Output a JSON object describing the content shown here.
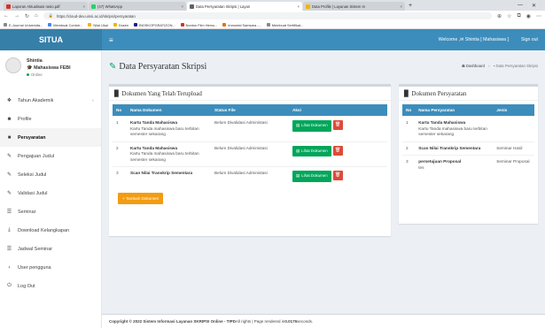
{
  "browser": {
    "tabs": [
      {
        "label": "Laporan Aktualisasi rasio.pdf",
        "color": "#d93025",
        "active": false
      },
      {
        "label": "(47) WhatsApp",
        "color": "#25d366",
        "active": false
      },
      {
        "label": "Data Persyaratan Skripsi | Layan",
        "color": "#5f6368",
        "active": true
      },
      {
        "label": "Data Profile | Layanan Sistem In",
        "color": "#f4b400",
        "active": false
      }
    ],
    "new_tab": "+",
    "url": "https://cloud-dev.uinsi.ac.id/skripsi/persyaratan",
    "bookmarks": [
      "E-Journal Universita...",
      "Membuat Contoh...",
      "Nilai Ukai",
      "Dosen",
      "BIOSKOPGRATIZON...",
      "Nonton Film Hemu...",
      "Immortal Samsara -...",
      "Membuat Sertifikat..."
    ]
  },
  "app": {
    "brand": "SITUA",
    "welcome": "Welcome ,✉ Shintia [ Mahasiswa ]",
    "signout": "Sign out"
  },
  "user": {
    "name": "Shintia",
    "role": "Mahasiswa FEBI",
    "status": "Online"
  },
  "sidebar": {
    "items": [
      {
        "label": "Tahun Akademik",
        "icon": "❖"
      },
      {
        "label": "Profile",
        "icon": "☻"
      },
      {
        "label": "Persyaratan",
        "icon": "■"
      },
      {
        "label": "Pengajuan Judul",
        "icon": "✎"
      },
      {
        "label": "Seleksi Judul",
        "icon": "✎"
      },
      {
        "label": "Validasi Judul",
        "icon": "✎"
      },
      {
        "label": "Seminar",
        "icon": "☰"
      },
      {
        "label": "Download Kelangkapan",
        "icon": "⤓"
      },
      {
        "label": "Jadwal Seminar",
        "icon": "☰"
      },
      {
        "label": "User pengguna",
        "icon": "‹"
      },
      {
        "label": "Log Out",
        "icon": "⏻"
      }
    ]
  },
  "page": {
    "title": "Data Persyaratan Skripsi",
    "breadcrumb_home": "Dashboard",
    "breadcrumb_current": "Data Persyaratan Skripsi"
  },
  "uploaded": {
    "title": "Dokumen Yang Telah Terupload",
    "headers": [
      "No",
      "Nama Dokumen",
      "Status File",
      "Aksi"
    ],
    "rows": [
      {
        "no": "1",
        "name": "Kartu Tanda Mahasiswa",
        "desc": "Kartu Tanda mahasiswa baru terbitan semester sekarang",
        "status": "Belum Divalidasi Administasi"
      },
      {
        "no": "2",
        "name": "Kartu Tanda Mahasiswa",
        "desc": "Kartu Tanda mahasiswa baru terbitan semester sekarang",
        "status": "Belum Divalidasi Administasi"
      },
      {
        "no": "3",
        "name": "Scan Nilai Transkrip Sementara",
        "desc": "",
        "status": "Belum Divalidasi Administasi"
      }
    ],
    "view_label": "Lihat Dokumen",
    "add_label": "+ Tambah Dokumen"
  },
  "requirements": {
    "title": "Dokumen Persyaratan",
    "headers": [
      "No",
      "Nama Persyaratan",
      "Jenis"
    ],
    "rows": [
      {
        "no": "1",
        "name": "Kartu Tanda Mahasiswa",
        "desc": "Kartu Tanda mahasiswa baru terbitan semester sekarang",
        "jenis": ""
      },
      {
        "no": "2",
        "name": "Scan Nilai Transkrip Sementara",
        "desc": "",
        "jenis": "Seminar Hasil"
      },
      {
        "no": "3",
        "name": "persetujuan Proposal",
        "desc": "tes",
        "jenis": "Seminar Proposal"
      }
    ]
  },
  "footer": {
    "copyright": "Copyright © 2022 Sistem Informasi Layanan SKRIPSI Online - TIPD",
    "rights": " All rights | Page rendered in ",
    "time": "0.0176",
    "seconds": " seconds."
  },
  "colors": {
    "brand": "#367fa9",
    "header": "#3c8dbc",
    "success": "#00a65a",
    "danger": "#dd4b39",
    "warning": "#f39c12"
  }
}
